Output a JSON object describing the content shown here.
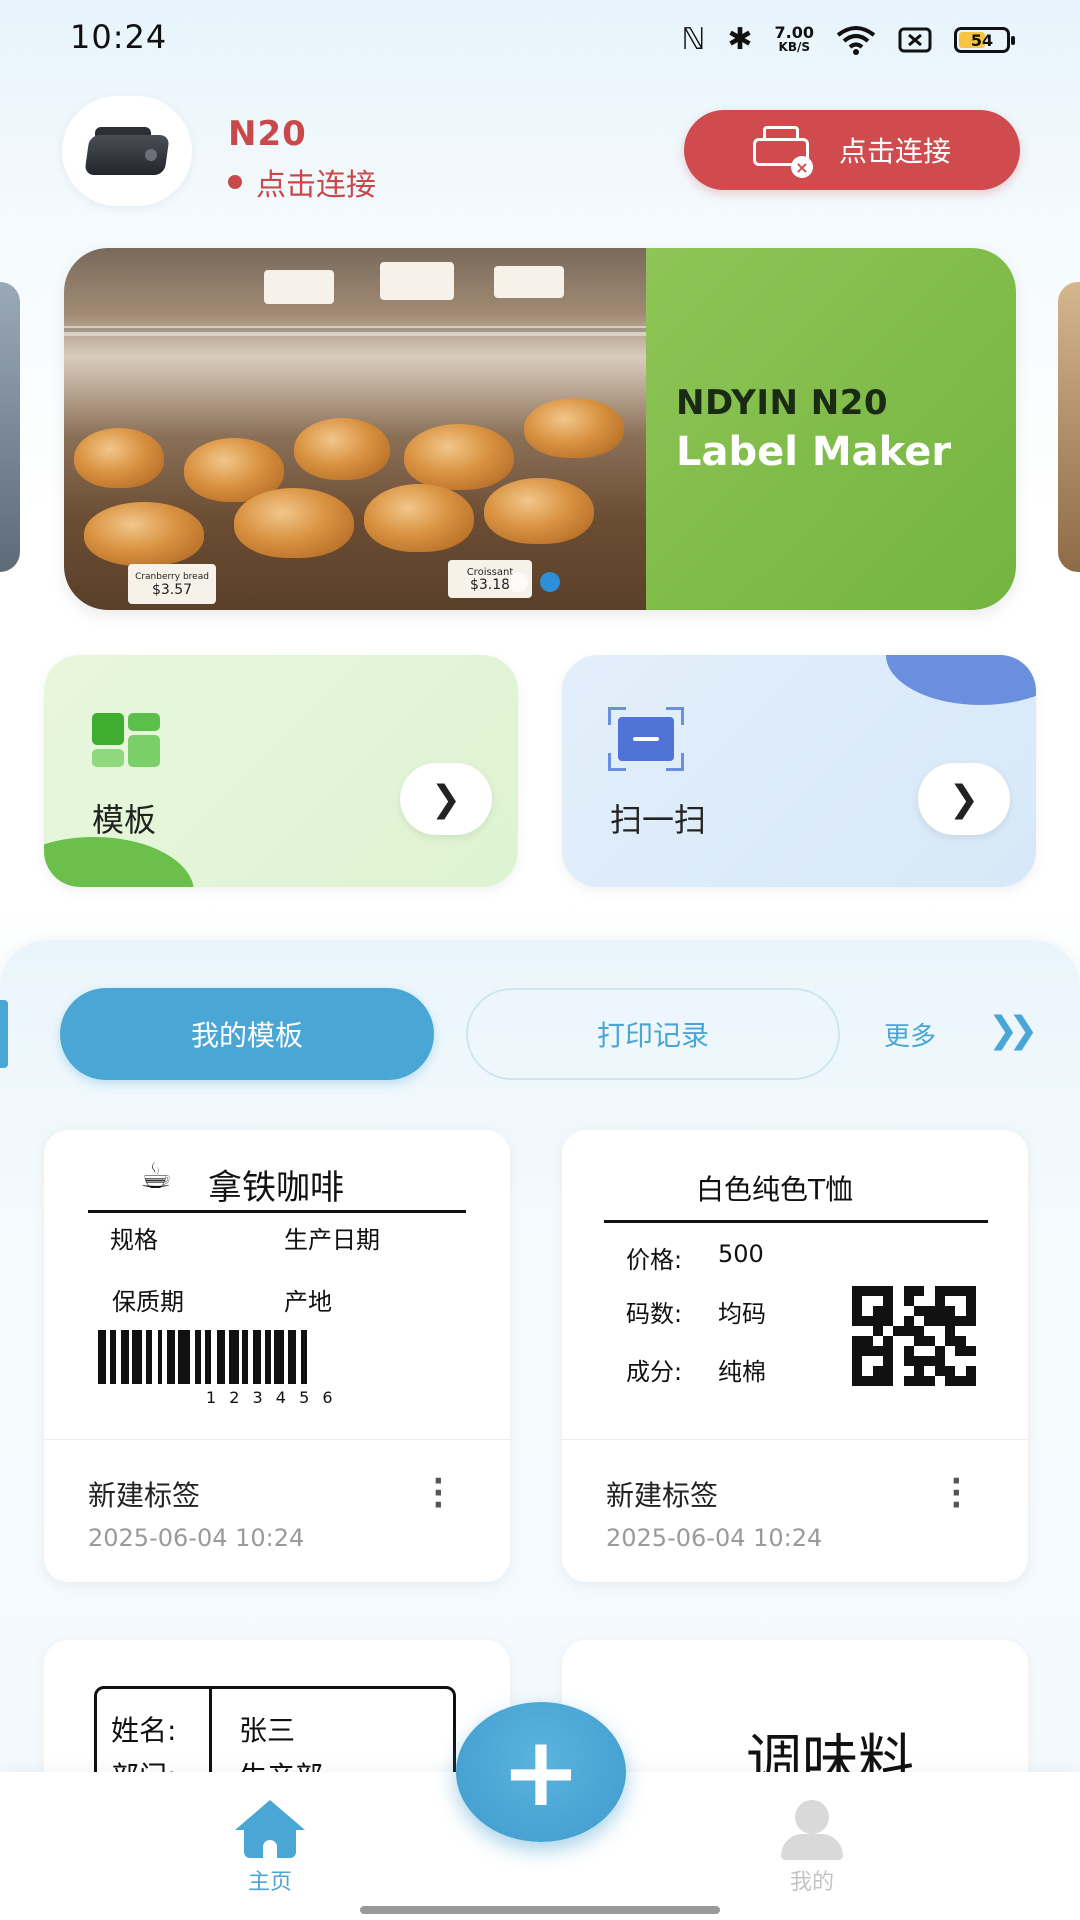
{
  "status_bar": {
    "time": "10:24",
    "net_speed_value": "7.00",
    "net_speed_unit": "KB/S",
    "battery": "54",
    "icons": [
      "nfc-icon",
      "bluetooth-icon",
      "wifi-icon",
      "sim-off-icon",
      "battery-icon"
    ]
  },
  "device": {
    "name": "N20",
    "status": "点击连接",
    "connect_button": "点击连接"
  },
  "banner": {
    "line1": "NDYIN N20",
    "line2": "Label Maker",
    "tag_left_line1": "Cranberry bread",
    "tag_left_price": "$3.57",
    "tag_right_line1": "Croissant",
    "tag_right_price": "$3.18",
    "dots_total": 2,
    "active_dot": 2
  },
  "features": {
    "template_label": "模板",
    "scan_label": "扫一扫"
  },
  "tabs": {
    "active": "我的模板",
    "second": "打印记录",
    "more": "更多"
  },
  "templates": [
    {
      "preview": {
        "title": "拿铁咖啡",
        "row1_left": "规格",
        "row1_right": "生产日期",
        "row2_left": "保质期",
        "row2_right": "产地",
        "barcode_number": "1 2 3 4 5 6"
      },
      "name": "新建标签",
      "date": "2025-06-04 10:24"
    },
    {
      "preview": {
        "title": "白色纯色T恤",
        "price_label": "价格:",
        "price_value": "500",
        "size_label": "码数:",
        "size_value": "均码",
        "material_label": "成分:",
        "material_value": "纯棉"
      },
      "name": "新建标签",
      "date": "2025-06-04 10:24"
    }
  ],
  "partial_templates": [
    {
      "name_label": "姓名:",
      "name_value": "张三",
      "dept_label": "部门:",
      "dept_value": "生产部"
    },
    {
      "title": "调味料"
    }
  ],
  "bottom_nav": {
    "home": "主页",
    "me": "我的",
    "add": "+"
  },
  "colors": {
    "brand_blue": "#4aa6d4",
    "connect_red": "#cf4b4d",
    "banner_green": "#8ec556"
  }
}
